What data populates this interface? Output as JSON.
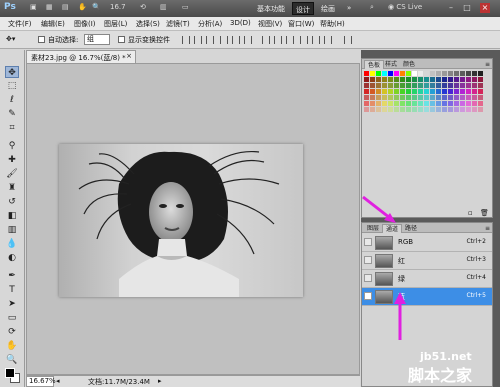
{
  "titlebar": {
    "logo": "Ps",
    "zoom": "16.7",
    "workspaces": [
      "基本功能",
      "设计",
      "绘画"
    ],
    "active_workspace": "设计",
    "more": "»",
    "cs_live": "CS Live",
    "minimize": "–",
    "restore": "□",
    "close": "×"
  },
  "menu": [
    "文件(F)",
    "编辑(E)",
    "图像(I)",
    "图层(L)",
    "选择(S)",
    "滤镜(T)",
    "分析(A)",
    "3D(D)",
    "视图(V)",
    "窗口(W)",
    "帮助(H)"
  ],
  "options": {
    "auto_select_label": "自动选择:",
    "auto_select_value": "组",
    "show_transform_label": "显示变换控件"
  },
  "document": {
    "tab_title": "素材23.jpg @ 16.7%(蓝/8) *",
    "zoom": "16.67%",
    "info": "文档:11.7M/23.4M"
  },
  "swatches_panel": {
    "tabs": [
      "色板",
      "样式",
      "颜色"
    ],
    "active_tab": "色板"
  },
  "channels_panel": {
    "tabs": [
      "图层",
      "通道",
      "路径"
    ],
    "active_tab": "通道",
    "channels": [
      {
        "name": "RGB",
        "shortcut": "Ctrl+2",
        "selected": false
      },
      {
        "name": "红",
        "shortcut": "Ctrl+3",
        "selected": false
      },
      {
        "name": "绿",
        "shortcut": "Ctrl+4",
        "selected": false
      },
      {
        "name": "蓝",
        "shortcut": "Ctrl+5",
        "selected": true
      }
    ]
  },
  "colors": {
    "accent": "#3d8ee6",
    "arrow": "#e020e0"
  },
  "watermark": {
    "line1": "jb51.net",
    "line2": "脚本之家"
  }
}
